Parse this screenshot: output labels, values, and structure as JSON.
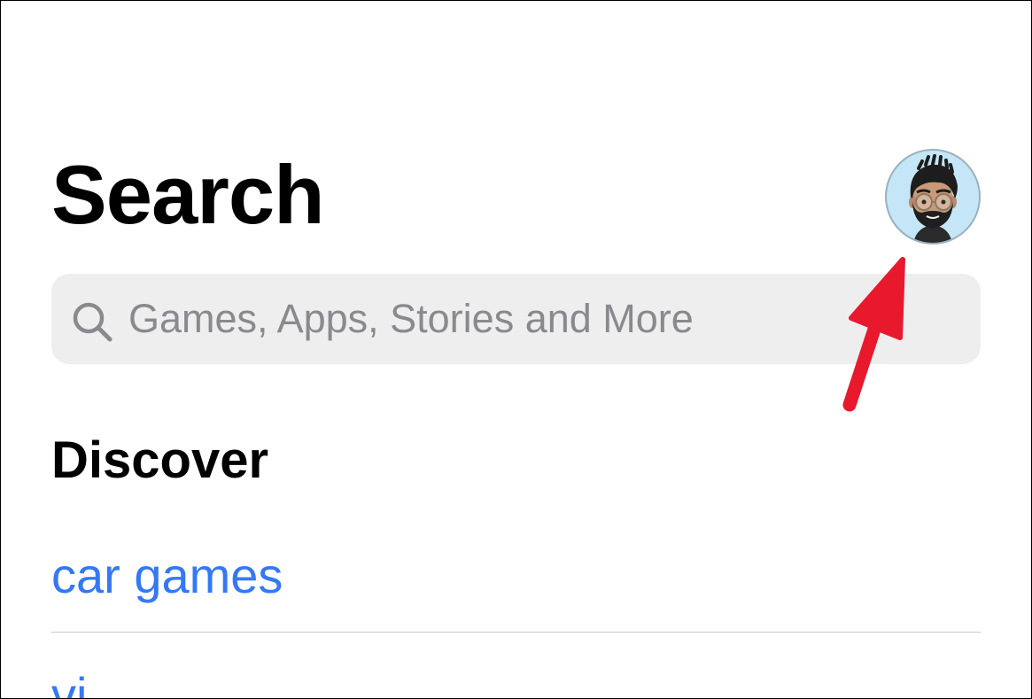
{
  "header": {
    "title": "Search"
  },
  "account": {
    "avatar_icon": "memoji-avatar-icon"
  },
  "search": {
    "placeholder": "Games, Apps, Stories and More",
    "icon": "search-icon"
  },
  "discover": {
    "title": "Discover",
    "items": [
      {
        "label": "car games"
      },
      {
        "label": "vi"
      }
    ]
  },
  "annotation": {
    "arrow_color": "#e8192c",
    "icon": "red-arrow-icon"
  },
  "colors": {
    "link": "#3478f6",
    "search_bg": "#eeeeef",
    "placeholder": "#8a8a8e",
    "avatar_bg": "#c5e6f7"
  }
}
